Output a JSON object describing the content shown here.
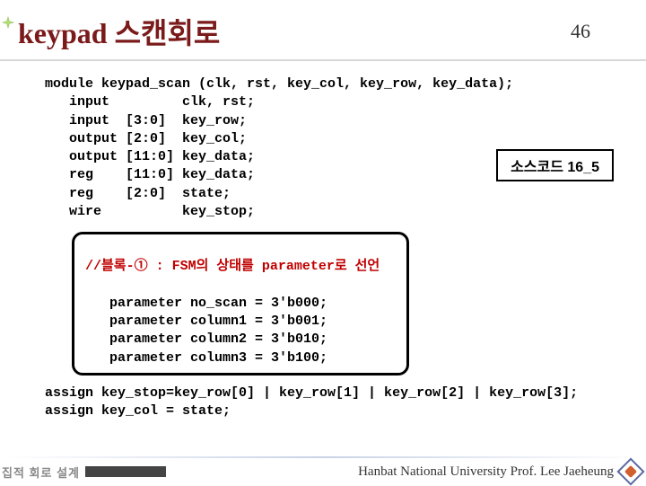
{
  "header": {
    "title": "keypad 스캔회로",
    "page_number": "46"
  },
  "source_label": "소스코드 16_5",
  "code": {
    "module_decl": "module keypad_scan (clk, rst, key_col, key_row, key_data);",
    "decls": [
      "   input         clk, rst;",
      "   input  [3:0]  key_row;",
      "   output [2:0]  key_col;",
      "   output [11:0] key_data;",
      "   reg    [11:0] key_data;",
      "   reg    [2:0]  state;",
      "   wire          key_stop;"
    ]
  },
  "block": {
    "comment": "//블록-① : FSM의 상태를 parameter로 선언",
    "lines": [
      "   parameter no_scan = 3'b000;",
      "   parameter column1 = 3'b001;",
      "   parameter column2 = 3'b010;",
      "   parameter column3 = 3'b100;"
    ]
  },
  "assigns": [
    "assign key_stop=key_row[0] | key_row[1] | key_row[2] | key_row[3];",
    "assign key_col = state;"
  ],
  "footer": {
    "left": "집적 회로 설계",
    "right": "Hanbat National University Prof. Lee Jaeheung"
  }
}
